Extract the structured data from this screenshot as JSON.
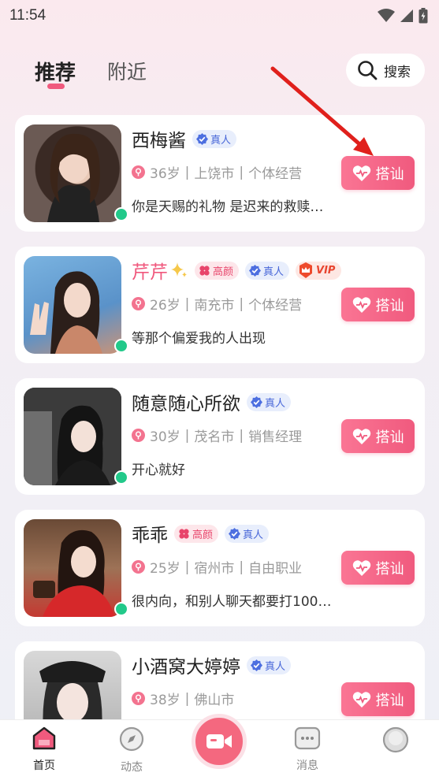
{
  "status_bar": {
    "time": "11:54"
  },
  "top_nav": {
    "tabs": [
      {
        "label": "推荐",
        "active": true
      },
      {
        "label": "附近",
        "active": false
      }
    ],
    "search_label": "搜索"
  },
  "cards": [
    {
      "name": "西梅酱",
      "name_pink": false,
      "badges": [
        "真人"
      ],
      "age": "36岁",
      "city": "上饶市",
      "job": "个体经营",
      "bio": "你是天赐的礼物 是迟来的救赎…",
      "button": "搭讪",
      "online": true
    },
    {
      "name": "芹芹",
      "name_pink": true,
      "badges": [
        "高颜",
        "真人",
        "VIP"
      ],
      "age": "26岁",
      "city": "南充市",
      "job": "个体经营",
      "bio": "等那个偏爱我的人出现",
      "button": "搭讪",
      "online": true
    },
    {
      "name": "随意随心所欲",
      "name_pink": false,
      "badges": [
        "真人"
      ],
      "age": "30岁",
      "city": "茂名市",
      "job": "销售经理",
      "bio": "开心就好",
      "button": "搭讪",
      "online": true
    },
    {
      "name": "乖乖",
      "name_pink": false,
      "badges": [
        "高颜",
        "真人"
      ],
      "age": "25岁",
      "city": "宿州市",
      "job": "自由职业",
      "bio": "很内向，和别人聊天都要打100…",
      "button": "搭讪",
      "online": true
    },
    {
      "name": "小酒窝大婷婷",
      "name_pink": false,
      "badges": [
        "真人"
      ],
      "age": "38岁",
      "city": "佛山市",
      "job": "",
      "bio": "",
      "button": "搭讪",
      "online": false
    }
  ],
  "bottom_nav": {
    "home": "首页",
    "moments": "动态",
    "messages": "消息",
    "profile": ""
  },
  "colors": {
    "accent": "#f05a7e",
    "online": "#22c98a",
    "real_badge": "#4766d8"
  }
}
